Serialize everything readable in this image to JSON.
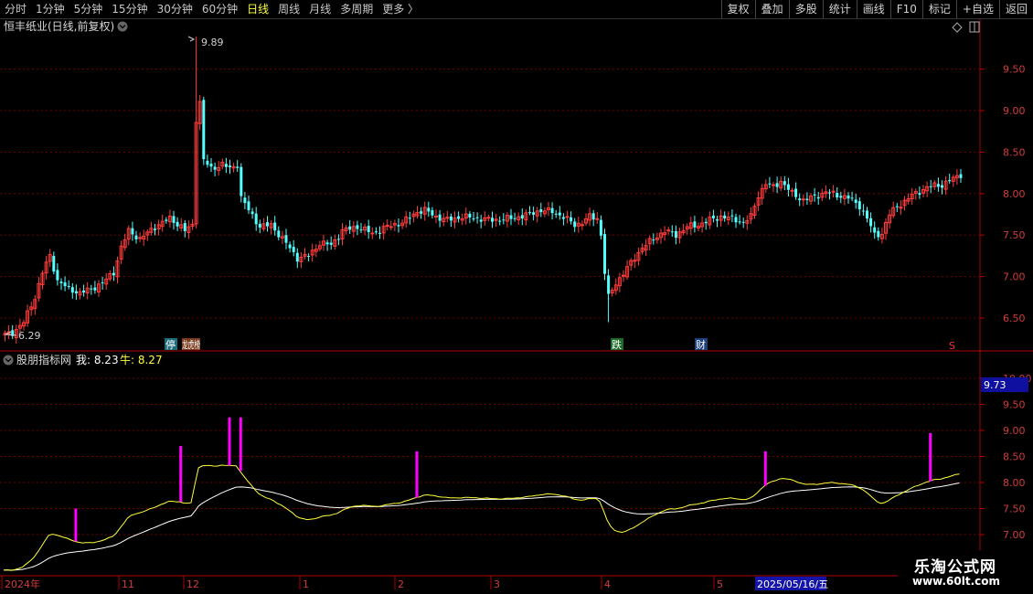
{
  "toolbar": {
    "periods": [
      "分时",
      "1分钟",
      "5分钟",
      "15分钟",
      "30分钟",
      "60分钟",
      "日线",
      "周线",
      "月线",
      "多周期",
      "更多 〉"
    ],
    "active_period": "日线",
    "buttons": [
      "复权",
      "叠加",
      "多股",
      "统计",
      "画线",
      "F10",
      "标记",
      "+自选",
      "返回"
    ]
  },
  "main_panel": {
    "title": "恒丰纸业(日线,前复权)",
    "high_label": "9.89",
    "low_label": "6.29",
    "y_ticks": [
      "9.50",
      "9.00",
      "8.50",
      "8.00",
      "7.50",
      "7.00",
      "6.50"
    ],
    "markers": [
      "停",
      "龙虎榜",
      "跌",
      "财",
      "S"
    ]
  },
  "indicator_panel": {
    "title": "股朋指标网",
    "wo_label": "我: 8.23",
    "niu_label": "牛: 8.27",
    "current_value": "9.73",
    "y_ticks": [
      "10.00",
      "9.50",
      "9.00",
      "8.50",
      "8.00",
      "7.50",
      "7.00"
    ]
  },
  "time_axis": {
    "labels": [
      "2024年",
      "11",
      "12",
      "1",
      "2",
      "3",
      "4",
      "5"
    ],
    "cursor_date": "2025/05/16/五"
  },
  "watermark": {
    "title": "乐淘公式网",
    "url": "www.60lt.com"
  },
  "colors": {
    "up": "#ff3c3c",
    "down": "#54ffff",
    "ma_white": "#ffffff",
    "ma_yellow": "#ffff3c",
    "signal": "#ff00ff",
    "axis": "#b00000",
    "grid": "#6e0000",
    "active": "#ffff3c"
  },
  "chart_data": [
    {
      "type": "candlestick",
      "title": "恒丰纸业(日线,前复权)",
      "ylim": [
        6.29,
        9.89
      ],
      "note": "daily candles approximated via close path (start 6.30, peak 9.89, end 8.23)"
    },
    {
      "type": "line",
      "title": "股朋指标网",
      "series": [
        {
          "name": "我",
          "last": 8.23
        },
        {
          "name": "牛",
          "last": 8.27
        }
      ],
      "ylim": [
        6.8,
        10.2
      ],
      "signal_count": 7
    }
  ]
}
